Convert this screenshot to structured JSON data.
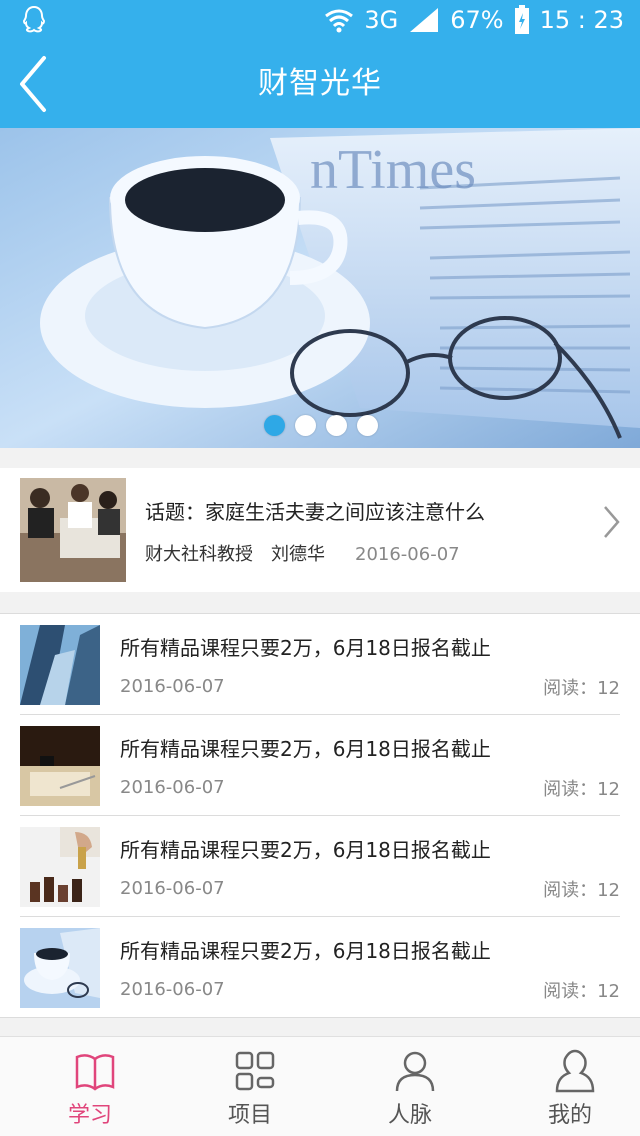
{
  "status_bar": {
    "network": "3G",
    "battery": "67%",
    "time": "15 : 23"
  },
  "header": {
    "title": "财智光华",
    "back_icon": "chevron-left-icon"
  },
  "banner": {
    "image": "coffee cup and newspaper with glasses",
    "slide_count": 4,
    "active_slide": 1
  },
  "topic": {
    "title": "话题：家庭生活夫妻之间应该注意什么",
    "author_title": "财大社科教授",
    "author_name": "刘德华",
    "date": "2016-06-07"
  },
  "list": [
    {
      "title": "所有精品课程只要2万，6月18日报名截止",
      "date": "2016-06-07",
      "reads": "阅读：12"
    },
    {
      "title": "所有精品课程只要2万，6月18日报名截止",
      "date": "2016-06-07",
      "reads": "阅读：12"
    },
    {
      "title": "所有精品课程只要2万，6月18日报名截止",
      "date": "2016-06-07",
      "reads": "阅读：12"
    },
    {
      "title": "所有精品课程只要2万，6月18日报名截止",
      "date": "2016-06-07",
      "reads": "阅读：12"
    }
  ],
  "tabs": [
    {
      "label": "学习",
      "icon": "book-icon",
      "active": true
    },
    {
      "label": "项目",
      "icon": "grid-icon",
      "active": false
    },
    {
      "label": "人脉",
      "icon": "person-icon",
      "active": false
    },
    {
      "label": "我的",
      "icon": "user-icon",
      "active": false
    }
  ],
  "colors": {
    "brand_blue": "#35b0ec",
    "active_pink": "#e0457b",
    "dot_active": "#2ea8e6"
  }
}
